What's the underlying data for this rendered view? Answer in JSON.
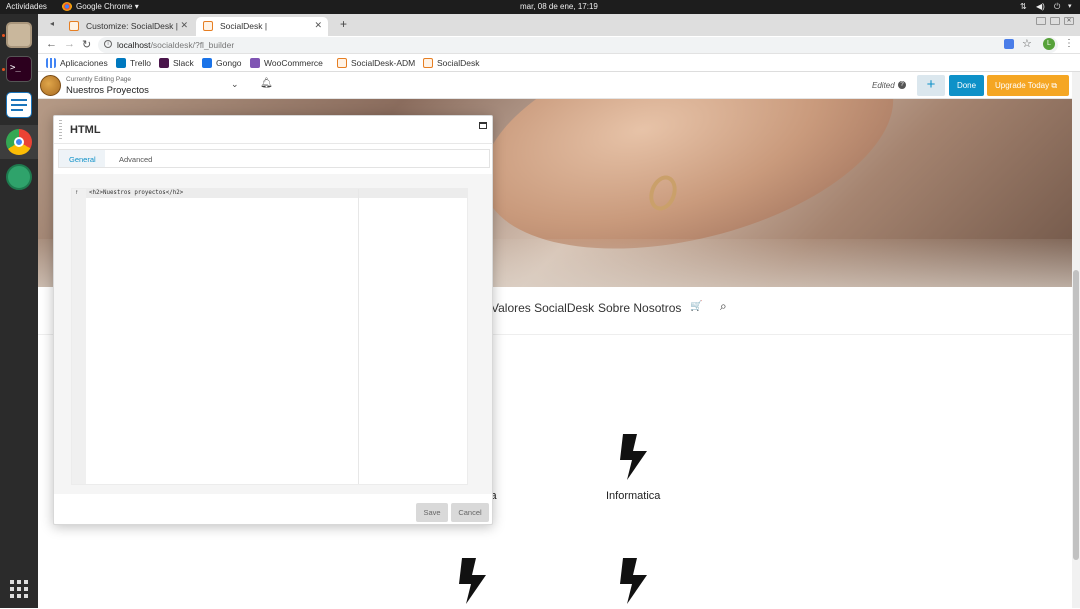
{
  "system": {
    "activities": "Actividades",
    "app_name": "Google Chrome ▾",
    "clock": "mar, 08 de ene, 17:19"
  },
  "browser": {
    "tabs": [
      {
        "title": "Customize: SocialDesk |"
      },
      {
        "title": "SocialDesk |"
      }
    ],
    "url_host": "localhost",
    "url_path": "/socialdesk/?fl_builder",
    "profile_initial": "L",
    "bookmarks": [
      "Aplicaciones",
      "Trello",
      "Slack",
      "Gongo",
      "WooCommerce",
      "SocialDesk-ADM",
      "SocialDesk"
    ]
  },
  "builder": {
    "editing_label": "Currently Editing Page",
    "page_name": "Nuestros Proyectos",
    "status": "Edited",
    "done_label": "Done",
    "upgrade_label": "Upgrade Today",
    "colors": {
      "done": "#0e91c8",
      "upgrade": "#f5a623",
      "plus_bg": "#dbe7ee"
    }
  },
  "page": {
    "nav_items": [
      "Valores SocialDesk",
      "Sobre Nosotros"
    ],
    "partial_label": "ca",
    "feature_label": "Informatica"
  },
  "modal": {
    "title": "HTML",
    "tabs": [
      "General",
      "Advanced"
    ],
    "active_tab": "General",
    "code": "<h2>Nuestros proyectos</h2>",
    "save_label": "Save",
    "cancel_label": "Cancel"
  }
}
